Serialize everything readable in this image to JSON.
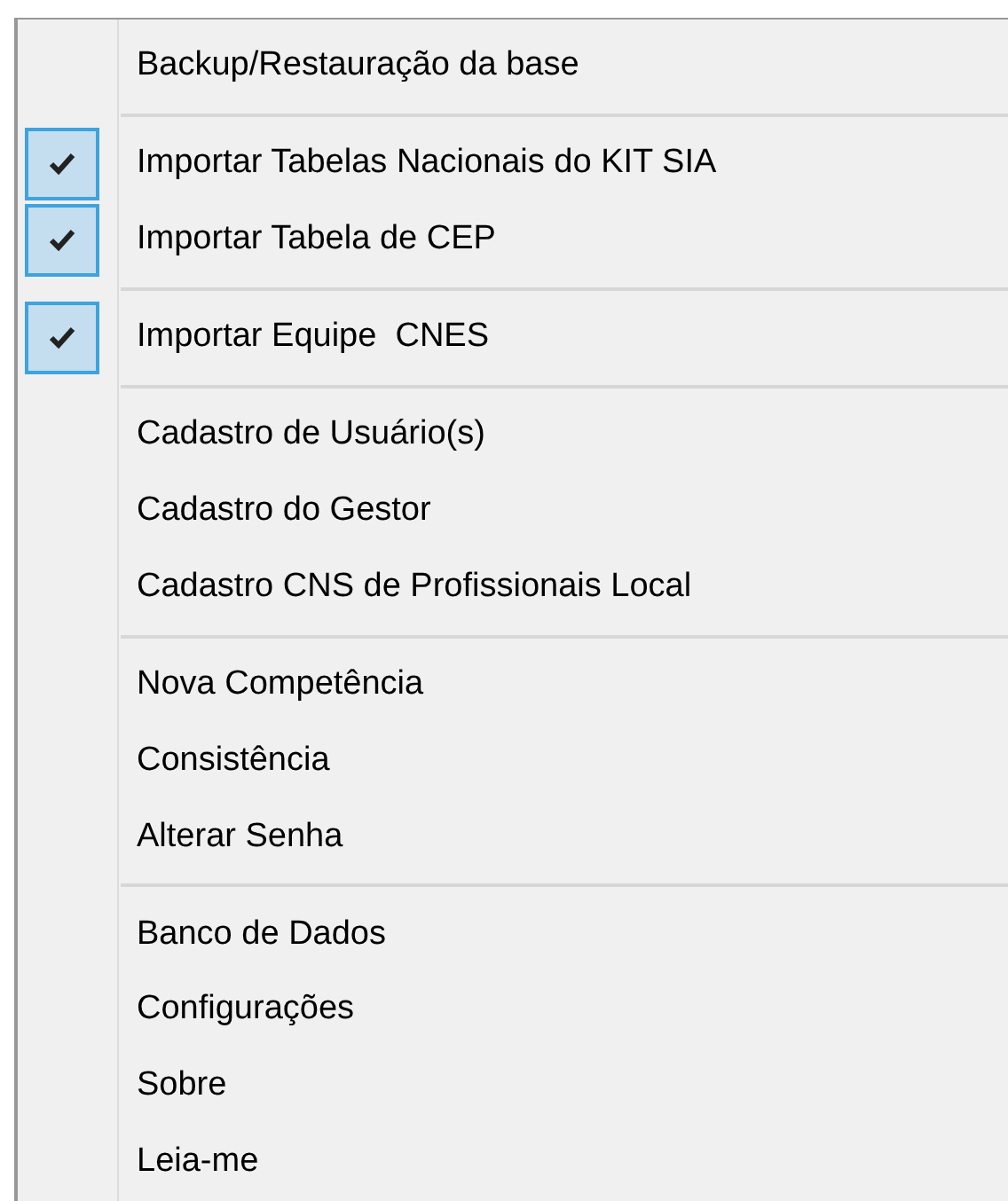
{
  "menu": {
    "items": [
      {
        "kind": "item",
        "label": "Backup/Restauração da base",
        "checked": false
      },
      {
        "kind": "separator"
      },
      {
        "kind": "item",
        "label": "Importar Tabelas Nacionais do KIT SIA",
        "checked": true
      },
      {
        "kind": "item",
        "label": "Importar Tabela de CEP",
        "checked": true
      },
      {
        "kind": "separator"
      },
      {
        "kind": "item",
        "label": "Importar Equipe  CNES",
        "checked": true
      },
      {
        "kind": "separator"
      },
      {
        "kind": "item",
        "label": "Cadastro de Usuário(s)",
        "checked": false
      },
      {
        "kind": "item",
        "label": "Cadastro do Gestor",
        "checked": false
      },
      {
        "kind": "item",
        "label": "Cadastro CNS de Profissionais Local",
        "checked": false
      },
      {
        "kind": "separator"
      },
      {
        "kind": "item",
        "label": "Nova Competência",
        "checked": false
      },
      {
        "kind": "item",
        "label": "Consistência",
        "checked": false
      },
      {
        "kind": "item",
        "label": "Alterar Senha",
        "checked": false
      },
      {
        "kind": "separator"
      },
      {
        "kind": "item",
        "label": "Banco de Dados",
        "checked": false
      },
      {
        "kind": "item",
        "label": "Configurações",
        "checked": false
      },
      {
        "kind": "item",
        "label": "Sobre",
        "checked": false
      },
      {
        "kind": "item",
        "label": "Leia-me",
        "checked": false
      }
    ]
  }
}
